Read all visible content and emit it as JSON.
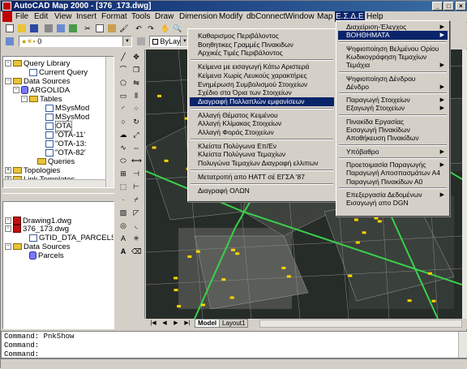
{
  "window": {
    "title": "AutoCAD Map 2000 - [376_173.dwg]",
    "controls": {
      "minimize": "_",
      "maximize": "□",
      "close": "×"
    }
  },
  "menubar": {
    "items": [
      "File",
      "Edit",
      "View",
      "Insert",
      "Format",
      "Tools",
      "Draw",
      "Dimension",
      "Modify",
      "dbConnect",
      "Window",
      "Map",
      "Ε.Σ.Δ.Ε",
      "Help"
    ],
    "active": "Ε.Σ.Δ.Ε"
  },
  "toolbar": {
    "layer_combo": "0",
    "linetype_combo": "ByLayer"
  },
  "workspace_tree": {
    "items": [
      {
        "label": "Query Library",
        "icon": "folder-icon",
        "expander": "-"
      },
      {
        "label": "Current Query",
        "icon": "query-icon",
        "expander": ""
      },
      {
        "label": "Data Sources",
        "icon": "folder-icon",
        "expander": "-"
      },
      {
        "label": "ARGOLIDA",
        "icon": "database-icon",
        "expander": "-"
      },
      {
        "label": "Tables",
        "icon": "folder-icon",
        "expander": "-"
      },
      {
        "label": "MSysMod",
        "icon": "table-icon",
        "expander": ""
      },
      {
        "label": "MSysMod",
        "icon": "table-icon",
        "expander": ""
      },
      {
        "label": "OTA",
        "icon": "table-icon",
        "expander": ""
      },
      {
        "label": "\"OTA-11'",
        "icon": "table-icon",
        "expander": ""
      },
      {
        "label": "\"OTA-13:",
        "icon": "table-icon",
        "expander": ""
      },
      {
        "label": "\"OTA-82'",
        "icon": "table-icon",
        "expander": ""
      },
      {
        "label": "Queries",
        "icon": "folder-icon",
        "expander": ""
      },
      {
        "label": "Topologies",
        "icon": "folder-icon",
        "expander": "+"
      },
      {
        "label": "Link Templates",
        "icon": "folder-icon",
        "expander": "+"
      }
    ]
  },
  "drawing_tree": {
    "items": [
      {
        "label": "Drawing1.dwg",
        "icon": "drawing-icon",
        "expander": "-"
      },
      {
        "label": "376_173.dwg",
        "icon": "drawing-icon",
        "expander": "-"
      },
      {
        "label": "GTID_DTA_PARCELS",
        "icon": "link-icon",
        "expander": ""
      },
      {
        "label": "Data Sources",
        "icon": "folder-icon",
        "expander": "-"
      },
      {
        "label": "Parcels",
        "icon": "database-icon",
        "expander": ""
      }
    ]
  },
  "submenu_left": {
    "items": [
      "Καθαρισμος Περιβάλοντος",
      "Βοηθητικες Γραμμές Πινακιδων",
      "Αρχικές Τιμές Περιβάλοντος",
      "---",
      "Κείμενα με εισαγωγή Κάτω Αριστερά",
      "Κείμενα Χωρίς Λευκούς χαρακτήρες",
      "Ενημέρωση Συμβολισμού Στοιχείων",
      "Σχέδιο στα Όρια των Στοιχείων",
      "Διαγραφή Πολλαπλών εμφανίσεων",
      "---",
      "Αλλαγή Θέματος Κειμένου",
      "Αλλαγή Κλίμακας Στοιχείων",
      "Αλλαγή Φοράς Στοιχείων",
      "---",
      "Κλείστα Πολύγωνα Επ/Εν",
      "Κλείστα Πολύγωνα Τεμαχίων",
      "Πολυγώνα Τεμαχίων Διαγραφή ελλιπων",
      "---",
      "Μετατροπή απο HATT σέ ΕΓΣΑ '87",
      "---",
      "Διαγραφή ΟΛΩΝ"
    ],
    "highlighted": "Διαγραφή Πολλαπλών εμφανίσεων"
  },
  "submenu_right": {
    "items": [
      {
        "label": "Διαχείριση-Έλεγχος",
        "sub": true
      },
      {
        "label": "ΒΟΗΘΗΜΑΤΑ",
        "sub": true
      },
      {
        "label": "---"
      },
      {
        "label": "Ψηφιοποίηση Βελμένου Ορίου",
        "sub": false
      },
      {
        "label": "Κωδικογράφηση Τεμαχίων",
        "sub": false
      },
      {
        "label": "Τεμάχια",
        "sub": true
      },
      {
        "label": "---"
      },
      {
        "label": "Ψηφιοποίηση Δένδρου",
        "sub": false
      },
      {
        "label": "Δένδρο",
        "sub": true
      },
      {
        "label": "---"
      },
      {
        "label": "Παραγωγή Στοιχείων",
        "sub": true
      },
      {
        "label": "Εξαγωγή Στοιχείων",
        "sub": true
      },
      {
        "label": "---"
      },
      {
        "label": "Πινακίδα Εργασίας",
        "sub": false
      },
      {
        "label": "Εισαγωγή Πινακίδων",
        "sub": false
      },
      {
        "label": "Αποθήκευση Πινακίδων",
        "sub": false
      },
      {
        "label": "---"
      },
      {
        "label": "Υπόβαθρο",
        "sub": true
      },
      {
        "label": "---"
      },
      {
        "label": "Προετοιμασία Παραγωγής",
        "sub": true
      },
      {
        "label": "Παραγωγή Αποσπασμάτων Α4",
        "sub": false
      },
      {
        "label": "Παραγωγή Πινακίδων Α0",
        "sub": false
      },
      {
        "label": "---"
      },
      {
        "label": "Επεξεργασία Δεδομένων",
        "sub": true
      },
      {
        "label": "Εισαγωγή απο DGN",
        "sub": false
      }
    ],
    "highlighted": "ΒΟΗΘΗΜΑΤΑ"
  },
  "layout_tabs": {
    "model": "Model",
    "layout1": "Layout1"
  },
  "command_lines": [
    "Command: PnkShow",
    "Command:",
    "Command:"
  ],
  "colors": {
    "accent": "#0a246a",
    "menu_bg": "#d4d0c8",
    "map_bg": "#1e2420",
    "road": "#3ad04a",
    "marker": "#ffd400"
  }
}
